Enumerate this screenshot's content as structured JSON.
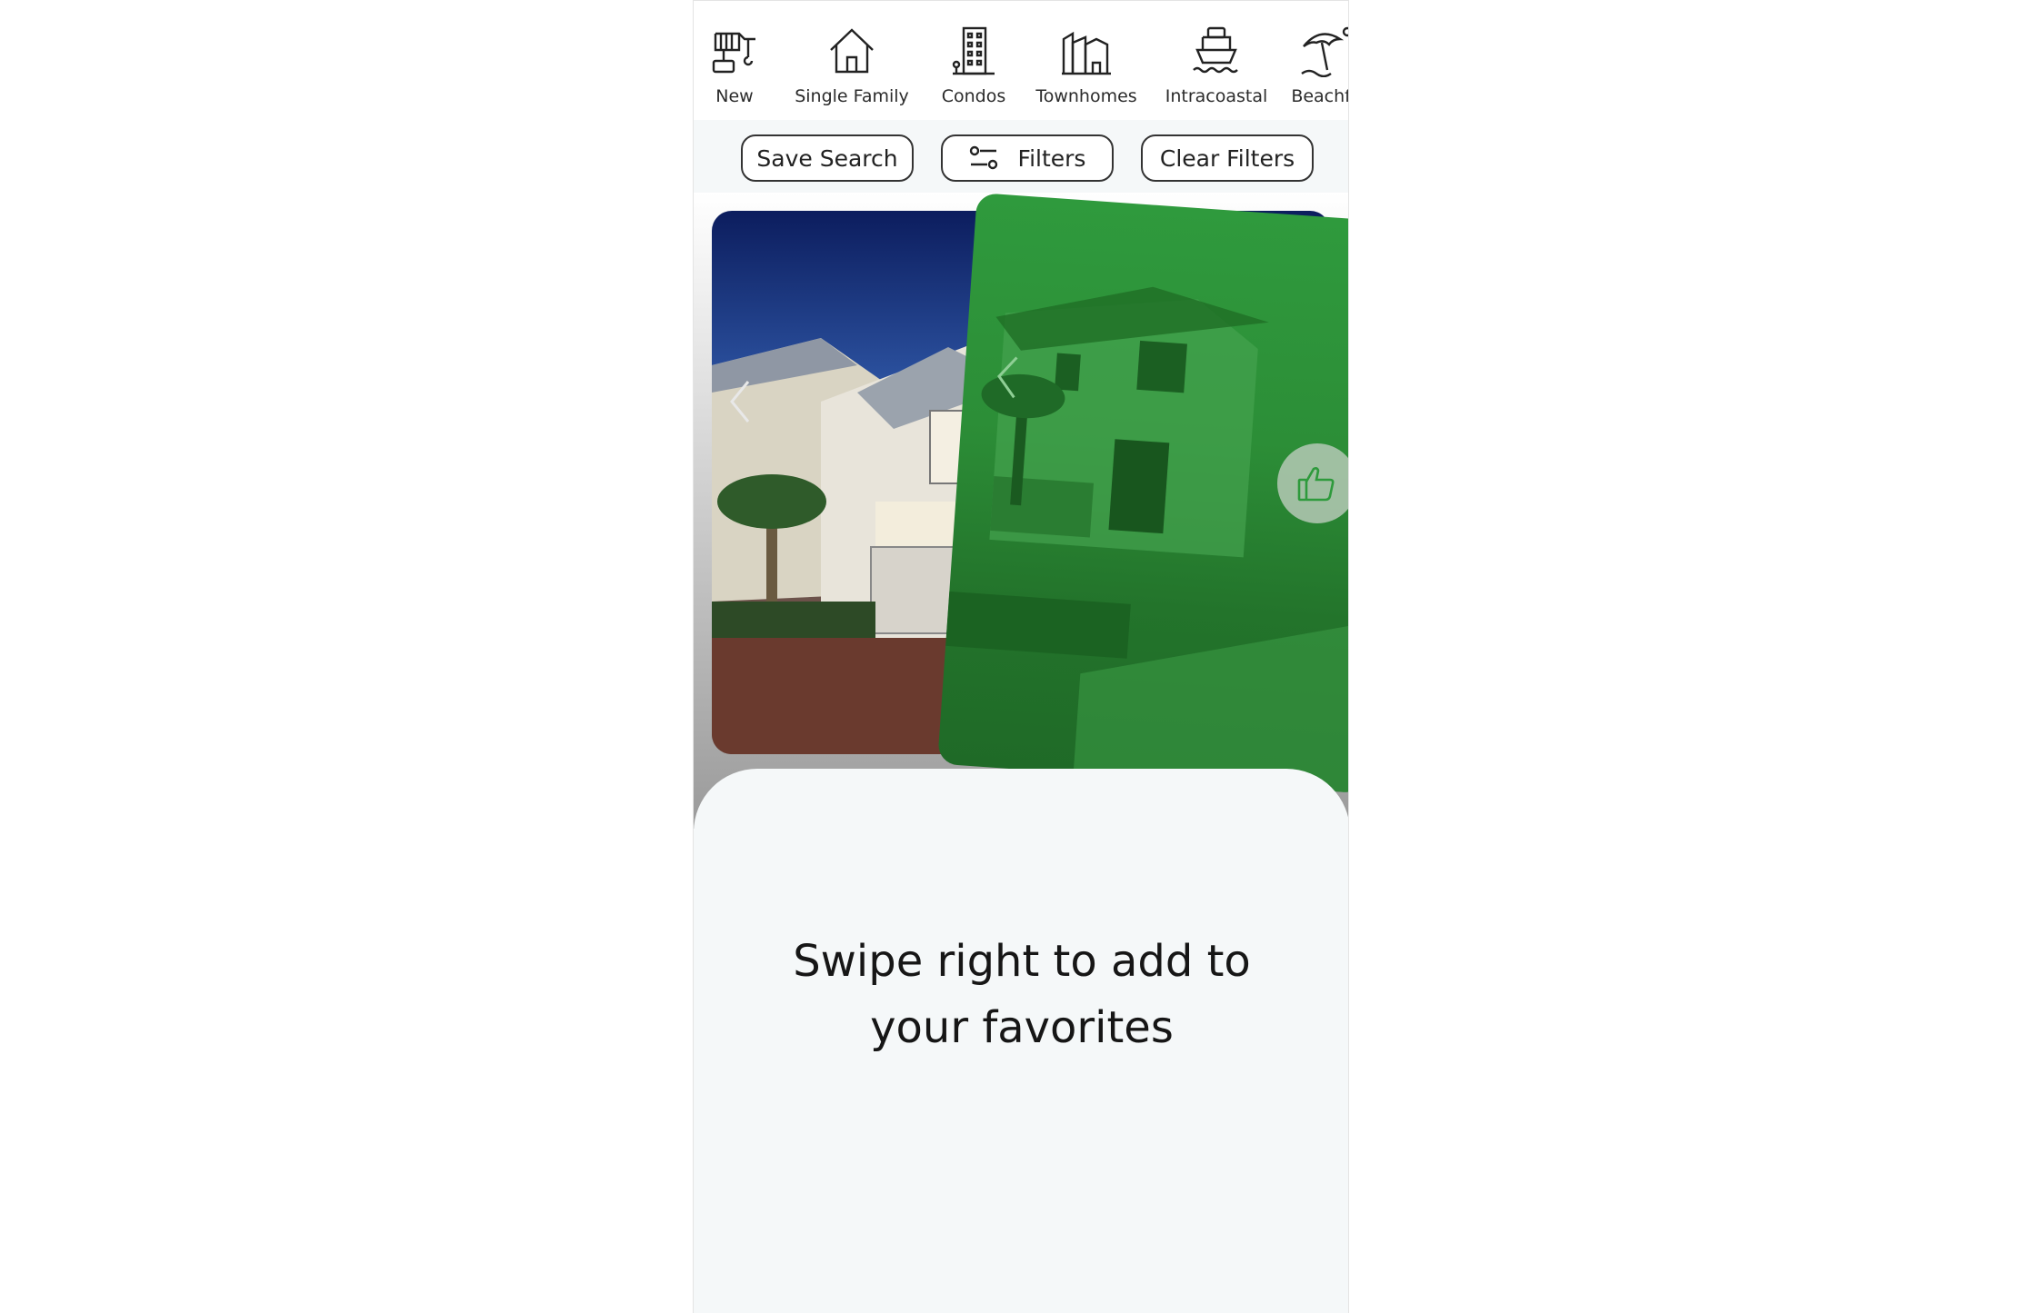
{
  "categories": [
    {
      "label": "New",
      "icon": "crane-icon"
    },
    {
      "label": "Single Family",
      "icon": "house-icon"
    },
    {
      "label": "Condos",
      "icon": "building-icon"
    },
    {
      "label": "Townhomes",
      "icon": "townhomes-icon"
    },
    {
      "label": "Intracoastal",
      "icon": "boat-icon"
    },
    {
      "label": "Beachfr",
      "icon": "beach-umbrella-icon"
    }
  ],
  "filters": {
    "save_search": "Save Search",
    "filters": "Filters",
    "clear_filters": "Clear Filters"
  },
  "overlay": {
    "like_color": "#2e9a3c",
    "message_line1": "Swipe right to add to",
    "message_line2": "your favorites"
  }
}
